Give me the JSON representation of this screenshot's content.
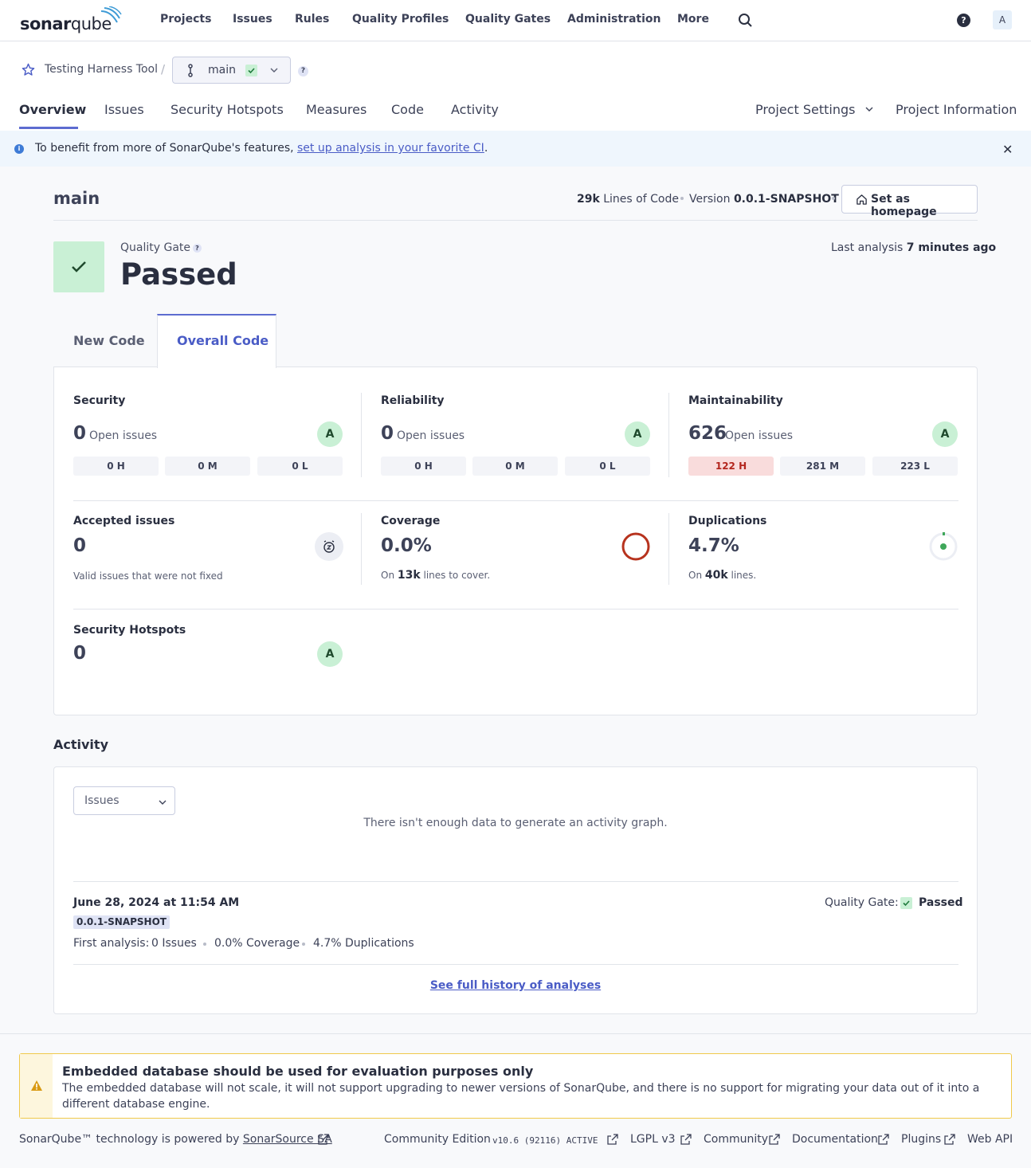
{
  "nav": {
    "logo_text_bold": "sonar",
    "logo_text_rest": "qube",
    "items": [
      "Projects",
      "Issues",
      "Rules",
      "Quality Profiles",
      "Quality Gates",
      "Administration",
      "More"
    ],
    "help": "?",
    "avatar": "A"
  },
  "project": {
    "name": "Testing Harness Tool",
    "separator": "/",
    "branch": "main",
    "branch_help": "?",
    "tabs": [
      "Overview",
      "Issues",
      "Security Hotspots",
      "Measures",
      "Code",
      "Activity"
    ],
    "right_tabs": [
      "Project Settings",
      "Project Information"
    ]
  },
  "banner": {
    "prefix": "To benefit from more of SonarQube's features, ",
    "link": "set up analysis in your favorite CI",
    "suffix": ".",
    "close": "✕"
  },
  "summary": {
    "branch_title": "main",
    "loc_value": "29k",
    "loc_label": " Lines of Code",
    "version_label": "Version ",
    "version_value": "0.0.1-SNAPSHOT",
    "homepage_button": "Set as homepage"
  },
  "quality_gate": {
    "label": "Quality Gate",
    "help": "?",
    "status": "Passed",
    "last_analysis_label": "Last analysis ",
    "last_analysis_value": "7 minutes ago"
  },
  "code_tabs": {
    "new": "New Code",
    "overall": "Overall Code"
  },
  "measures": {
    "security": {
      "title": "Security",
      "value": "0",
      "label": "Open issues",
      "grade": "A",
      "sev": [
        "0 H",
        "0 M",
        "0 L"
      ]
    },
    "reliability": {
      "title": "Reliability",
      "value": "0",
      "label": "Open issues",
      "grade": "A",
      "sev": [
        "0 H",
        "0 M",
        "0 L"
      ]
    },
    "maintainability": {
      "title": "Maintainability",
      "value": "626",
      "label": "Open issues",
      "grade": "A",
      "sev": [
        "122 H",
        "281 M",
        "223 L"
      ]
    },
    "accepted": {
      "title": "Accepted issues",
      "value": "0",
      "note": "Valid issues that were not fixed"
    },
    "coverage": {
      "title": "Coverage",
      "value": "0.0%",
      "note_prefix": "On ",
      "note_value": "13k",
      "note_suffix": " lines to cover.",
      "fraction": 0.0,
      "color": "#b7331e"
    },
    "duplications": {
      "title": "Duplications",
      "value": "4.7%",
      "note_prefix": "On ",
      "note_value": "40k",
      "note_suffix": " lines.",
      "color": "#3fa75a"
    },
    "hotspots": {
      "title": "Security Hotspots",
      "value": "0",
      "grade": "A"
    }
  },
  "activity": {
    "title": "Activity",
    "select": "Issues",
    "empty": "There isn't enough data to generate an activity graph.",
    "analysis_date": "June 28, 2024 at 11:54 AM",
    "analysis_version": "0.0.1-SNAPSHOT",
    "qg_label": "Quality Gate:",
    "qg_status": "Passed",
    "first_analysis": "First analysis:",
    "issues": "0 Issues",
    "coverage": "0.0% Coverage",
    "duplications": "4.7% Duplications",
    "history_link": "See full history of analyses"
  },
  "warning": {
    "title": "Embedded database should be used for evaluation purposes only",
    "text": "The embedded database will not scale, it will not support upgrading to newer versions of SonarQube, and there is no support for migrating your data out of it into a different database engine."
  },
  "footer": {
    "powered_prefix": "SonarQube™ technology is powered by ",
    "powered_link": "SonarSource SA",
    "edition": "Community Edition",
    "version": "v10.6 (92116) ACTIVE",
    "license": "LGPL v3",
    "community": "Community",
    "documentation": "Documentation",
    "plugins": "Plugins",
    "webapi": "Web API"
  },
  "colors": {
    "accent": "#5d6cd0",
    "grade_a": "#c9f0d5",
    "high": "#b3261e"
  }
}
